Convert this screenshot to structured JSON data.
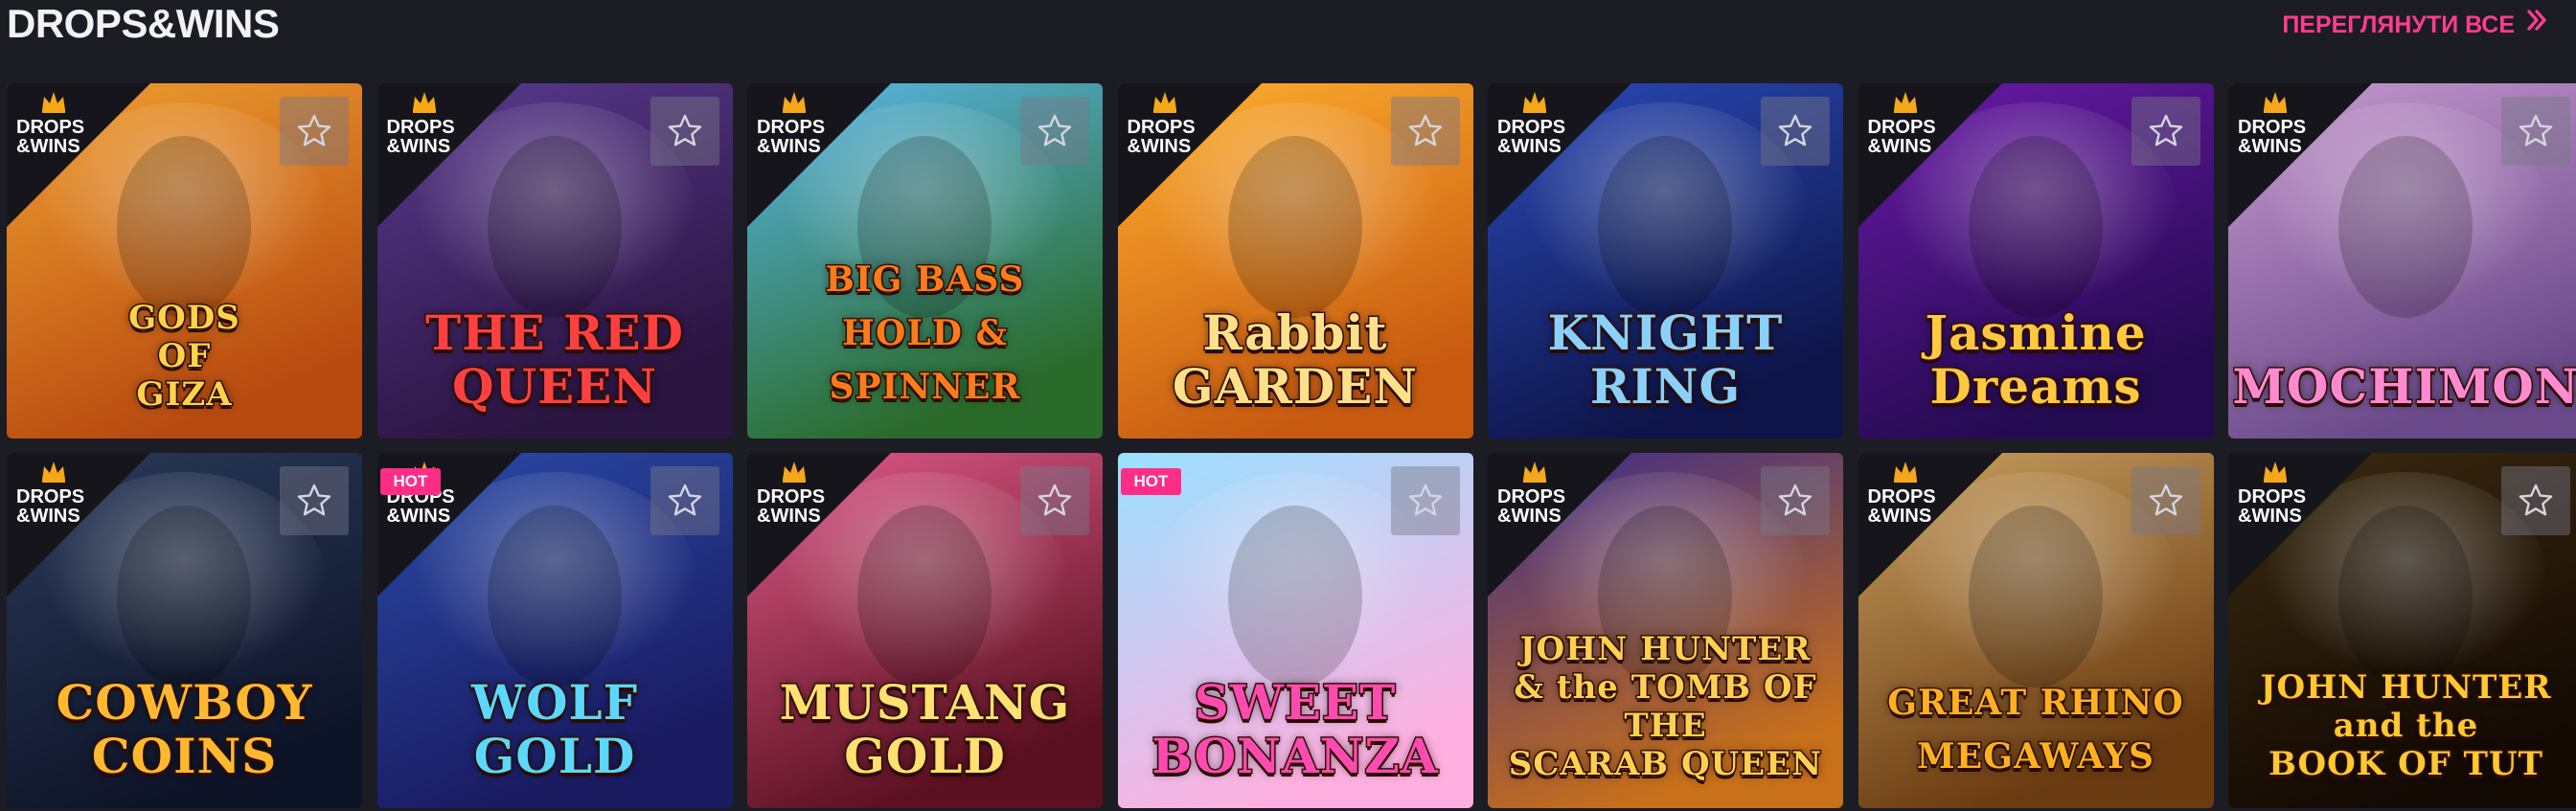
{
  "section": {
    "title": "DROPS&WINS",
    "view_all_label": "ПЕРЕГЛЯНУТИ ВСЕ"
  },
  "badges": {
    "drops_wins": "DROPS\n&WINS",
    "hot": "HOT"
  },
  "games": [
    {
      "title": "GODS\nOF\nGIZA",
      "dw": true,
      "hot": false,
      "bg1": "#f0a030",
      "bg2": "#b84a10",
      "title_color": "#ffd24a"
    },
    {
      "title": "THE RED QUEEN",
      "dw": true,
      "hot": false,
      "bg1": "#5a3a90",
      "bg2": "#2a1440",
      "title_color": "#ff4040"
    },
    {
      "title": "BIG BASS\nHOLD & SPINNER",
      "dw": true,
      "hot": false,
      "bg1": "#5ab8ea",
      "bg2": "#2a6a2a",
      "title_color": "#ff7a1a"
    },
    {
      "title": "Rabbit\nGARDEN",
      "dw": true,
      "hot": false,
      "bg1": "#ffb030",
      "bg2": "#c85a10",
      "title_color": "#ffe08a"
    },
    {
      "title": "KNIGHT RING",
      "dw": true,
      "hot": false,
      "bg1": "#2a4ab8",
      "bg2": "#0e1448",
      "title_color": "#8ad0ff"
    },
    {
      "title": "Jasmine\nDreams",
      "dw": true,
      "hot": false,
      "bg1": "#6a1aa8",
      "bg2": "#240a50",
      "title_color": "#ffc840"
    },
    {
      "title": "MOCHIMON",
      "dw": true,
      "hot": false,
      "bg1": "#c89ad0",
      "bg2": "#6a4a8a",
      "title_color": "#ff8ad0"
    },
    {
      "title": "COWBOY\nCOINS",
      "dw": true,
      "hot": false,
      "bg1": "#2a3a5a",
      "bg2": "#0e1428",
      "title_color": "#ffb830"
    },
    {
      "title": "WOLF\nGOLD",
      "dw": true,
      "hot": true,
      "bg1": "#2a4aa8",
      "bg2": "#1a1a60",
      "title_color": "#5ad8ff"
    },
    {
      "title": "MUSTANG\nGOLD",
      "dw": true,
      "hot": false,
      "bg1": "#e05a8a",
      "bg2": "#5a1020",
      "title_color": "#ffe070"
    },
    {
      "title": "SWEET\nBONANZA",
      "dw": false,
      "hot": true,
      "bg1": "#9ae0ff",
      "bg2": "#ffb0e0",
      "title_color": "#ff4ab0"
    },
    {
      "title": "JOHN HUNTER\n& the TOMB OF THE\nSCARAB QUEEN",
      "dw": true,
      "hot": false,
      "bg1": "#3a2a8a",
      "bg2": "#c8701a",
      "title_color": "#ffd050"
    },
    {
      "title": "GREAT RHINO\nMEGAWAYS",
      "dw": true,
      "hot": false,
      "bg1": "#c8a060",
      "bg2": "#6a3a10",
      "title_color": "#ffb020"
    },
    {
      "title": "JOHN HUNTER\nand the\nBOOK OF TUT",
      "dw": true,
      "hot": false,
      "bg1": "#3a2a10",
      "bg2": "#140a04",
      "title_color": "#ffc830"
    }
  ],
  "icons": {
    "star": "star-outline-icon",
    "crown": "crown-icon",
    "chevron": "double-chevron-right-icon"
  },
  "colors": {
    "page_bg": "#1c1c24",
    "accent": "#ff3d8e",
    "hot_badge": "#ff2d86",
    "ribbon": "#15151b"
  }
}
